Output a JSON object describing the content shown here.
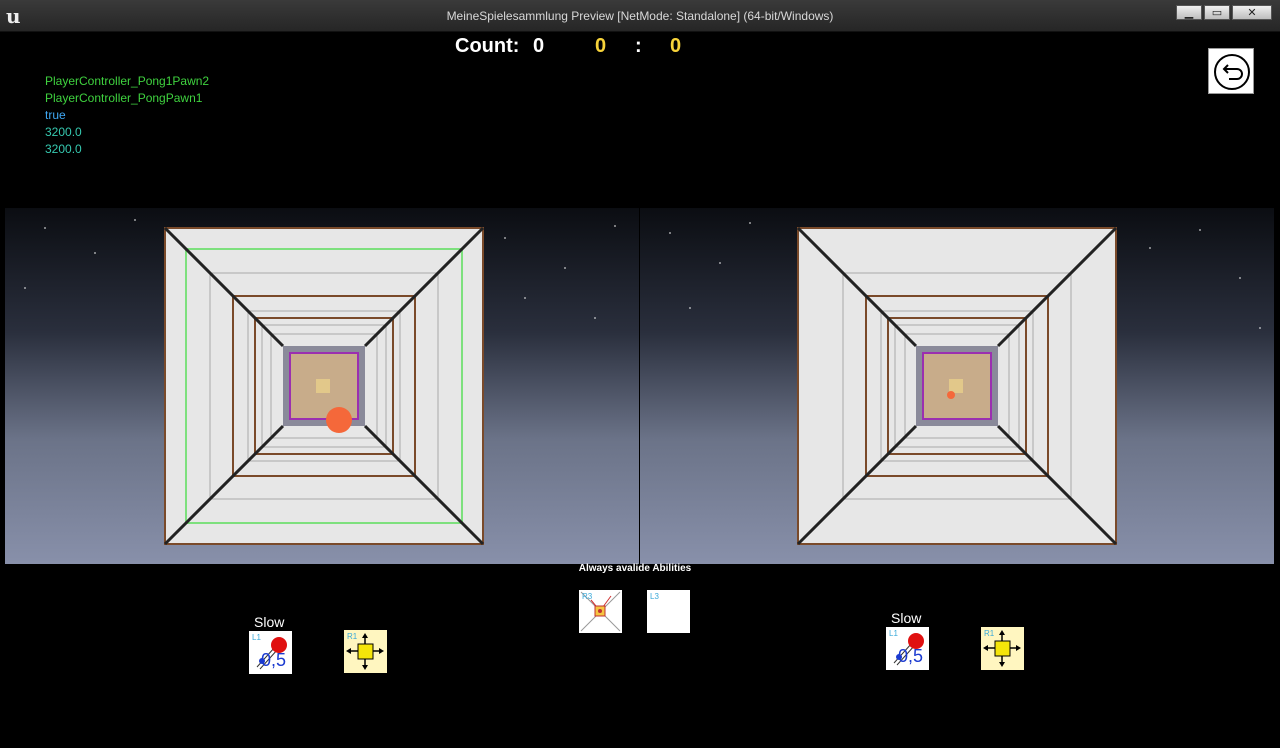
{
  "window": {
    "title": "MeineSpielesammlung Preview [NetMode: Standalone]  (64-bit/Windows)",
    "minimize_label": "▁",
    "maximize_label": "▭",
    "close_label": "✕"
  },
  "hud": {
    "count_label": "Count:",
    "count_value": "0",
    "score_left": "0",
    "separator": ":",
    "score_right": "0"
  },
  "debug_lines": [
    "PlayerController_Pong1Pawn2",
    "PlayerController_PongPawn1",
    "true",
    "3200.0",
    "3200.0"
  ],
  "abilities": {
    "always_label": "Always avalide Abilities",
    "left": {
      "slow_label": "Slow",
      "slow_key": "L1",
      "slow_value": "0,5",
      "move_key": "R1"
    },
    "right": {
      "slow_label": "Slow",
      "slow_key": "L1",
      "slow_value": "0,5",
      "move_key": "R1"
    },
    "center": {
      "split_key": "R3",
      "blank_key": "L3"
    }
  },
  "icons": {
    "logo": "unreal-logo-icon",
    "back": "back-arrow-icon"
  }
}
